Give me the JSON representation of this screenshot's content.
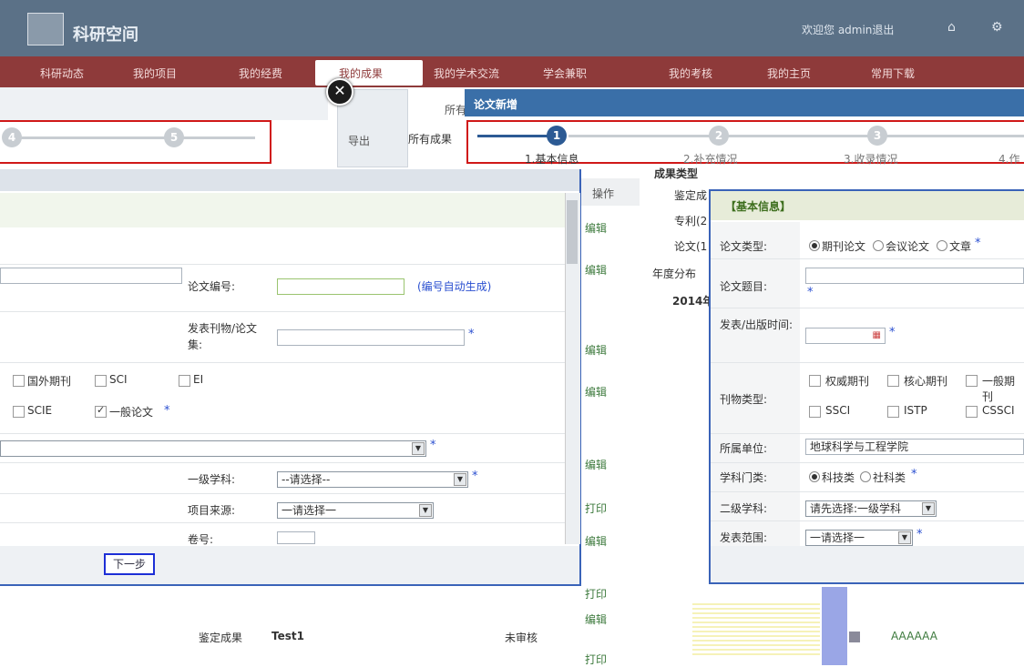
{
  "header": {
    "logo_text": "科研空间",
    "right_text": "欢迎您 admin退出"
  },
  "nav": {
    "items": [
      "科研动态",
      "我的项目",
      "我的经费",
      "我的学术交流",
      "学会兼职",
      "我的考核",
      "我的主页",
      "常用下载"
    ],
    "active": "我的成果"
  },
  "background": {
    "export_label": "导出",
    "all_label": "所有",
    "all_results_button": "所有成果"
  },
  "left_dialog": {
    "paper_number_label": "论文编号:",
    "paper_number_hint": "(编号自动生成)",
    "journal_label": "发表刊物/论文集:",
    "checkboxes_row1": [
      "国外期刊",
      "SCI",
      "EI"
    ],
    "checkboxes_row2": [
      "SCIE",
      "一般论文"
    ],
    "checked": "一般论文",
    "discipline_label": "一级学科:",
    "discipline_value": "--请选择--",
    "project_source_label": "项目来源:",
    "project_source_value": "一请选择一",
    "volume_label": "卷号:",
    "next_button": "下一步"
  },
  "steps_left": {
    "nums": [
      "4",
      "5"
    ]
  },
  "middle": {
    "header": "操作",
    "links": [
      "编辑",
      "编辑",
      "编辑",
      "编辑",
      "编辑",
      "打印",
      "编辑",
      "打印",
      "编辑",
      "打印"
    ]
  },
  "summary": {
    "title": "成果类型",
    "items": [
      "鉴定成",
      "专利(2",
      "论文(1"
    ],
    "year_label": "年度分布",
    "year_value": "2014年"
  },
  "right_dialog": {
    "title": "论文新增",
    "steps": [
      {
        "num": "1",
        "label": "1.基本信息"
      },
      {
        "num": "2",
        "label": "2.补充情况"
      },
      {
        "num": "3",
        "label": "3.收录情况"
      },
      {
        "num": "4",
        "label": "4.作"
      }
    ],
    "section_title": "【基本信息】",
    "paper_type_label": "论文类型:",
    "paper_types": [
      "期刊论文",
      "会议论文",
      "文章"
    ],
    "paper_title_label": "论文题目:",
    "publish_time_label": "发表/出版时间:",
    "journal_type_label": "刊物类型:",
    "journal_types_row1": [
      "权威期刊",
      "核心期刊",
      "一般期刊"
    ],
    "journal_types_row2": [
      "SSCI",
      "ISTP",
      "CSSCI"
    ],
    "unit_label": "所属单位:",
    "unit_value": "地球科学与工程学院",
    "category_label": "学科门类:",
    "categories": [
      "科技类",
      "社科类"
    ],
    "second_discipline_label": "二级学科:",
    "second_discipline_value": "请先选择:一级学科",
    "publish_range_label": "发表范围:",
    "publish_range_value": "一请选择一"
  },
  "table_bottom": {
    "row_type": "鉴定成果",
    "row_name": "Test1",
    "row_status": "未审核",
    "right_name": "AAAAAA"
  }
}
